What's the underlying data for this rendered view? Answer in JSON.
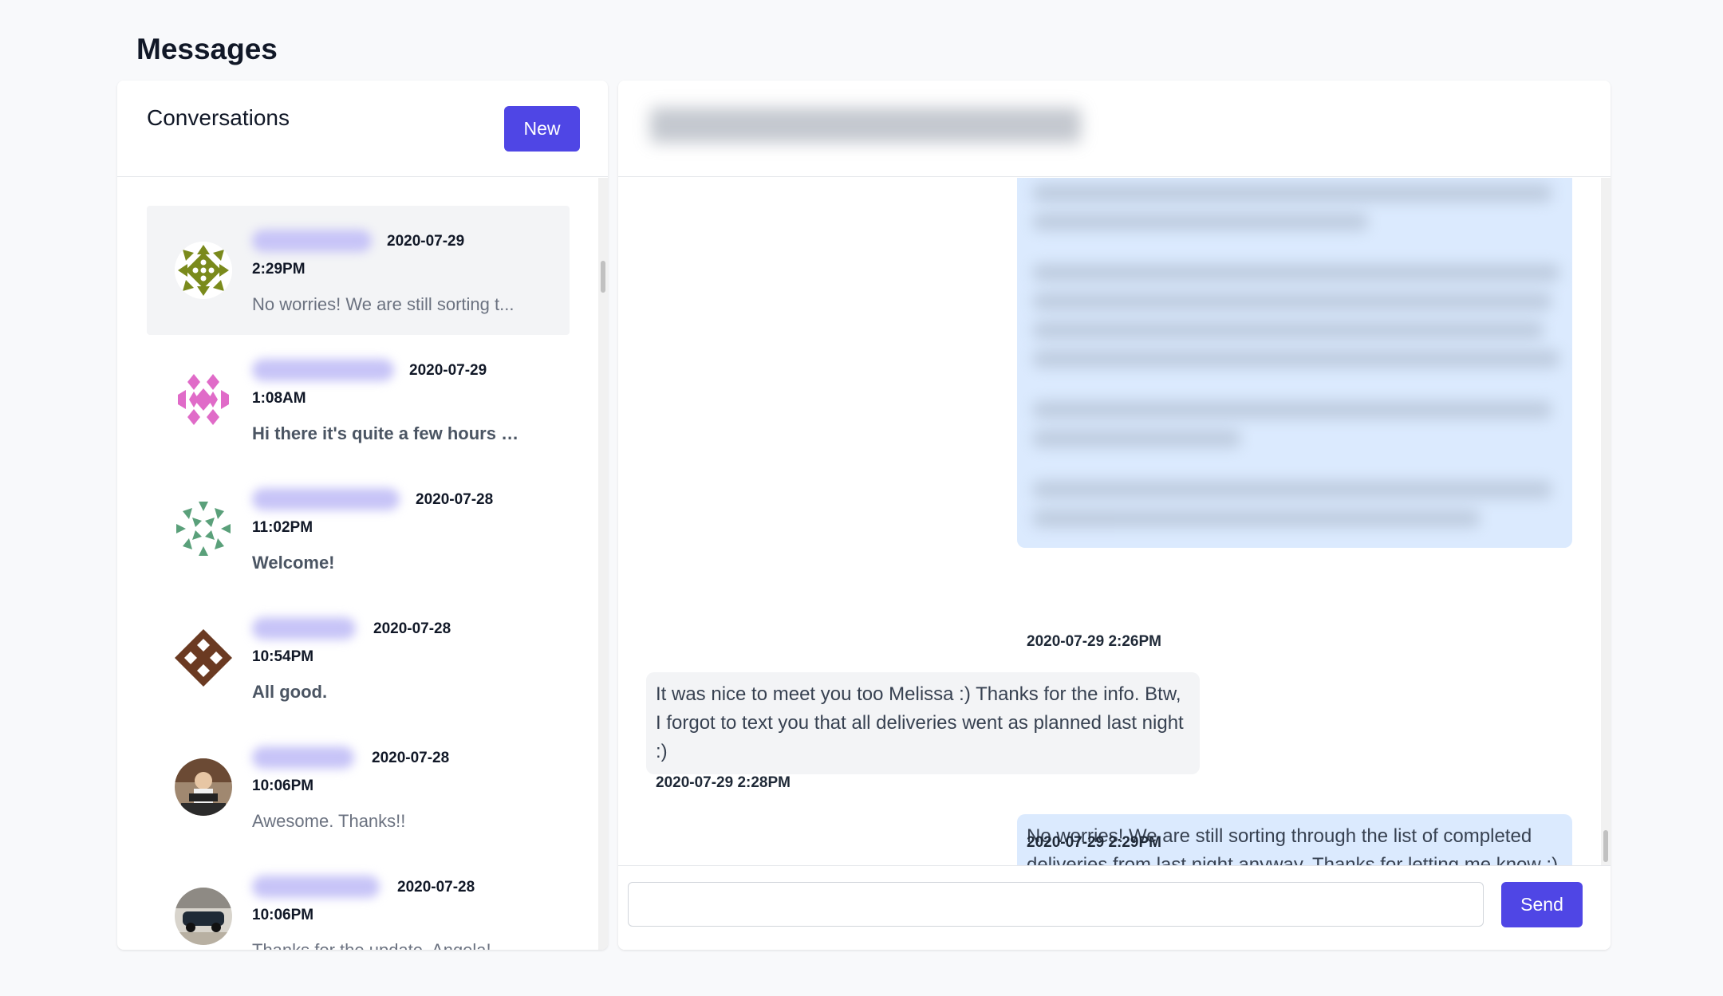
{
  "page": {
    "title": "Messages"
  },
  "conversations": {
    "heading": "Conversations",
    "new_label": "New",
    "items": [
      {
        "date": "2020-07-29",
        "time": "2:29PM",
        "preview": "No worries! We are still sorting t...",
        "unread": false,
        "active": true,
        "avatar": "identicon-olive",
        "color": "#7a8a1c"
      },
      {
        "date": "2020-07-29",
        "time": "1:08AM",
        "preview": "Hi there it's quite a few hours la...",
        "unread": true,
        "active": false,
        "avatar": "identicon-pink",
        "color": "#e06bc8"
      },
      {
        "date": "2020-07-28",
        "time": "11:02PM",
        "preview": "Welcome!",
        "unread": true,
        "active": false,
        "avatar": "identicon-green",
        "color": "#5aa07a"
      },
      {
        "date": "2020-07-28",
        "time": "10:54PM",
        "preview": "All good.",
        "unread": true,
        "active": false,
        "avatar": "identicon-brown",
        "color": "#6b3a22"
      },
      {
        "date": "2020-07-28",
        "time": "10:06PM",
        "preview": "Awesome. Thanks!!",
        "unread": false,
        "active": false,
        "avatar": "photo-avatar-person",
        "color": "#8a5a3c"
      },
      {
        "date": "2020-07-28",
        "time": "10:06PM",
        "preview": "Thanks for the update, Angela!",
        "unread": false,
        "active": false,
        "avatar": "photo-avatar-car",
        "color": "#5a6470"
      }
    ]
  },
  "chat": {
    "messages": [
      {
        "from": "me",
        "text": "",
        "blurred": true,
        "time": "2020-07-29 2:26PM"
      },
      {
        "from": "them",
        "text": "It was nice to meet you too Melissa :) Thanks for the info. Btw, I forgot to text you that all deliveries went as planned last night :)",
        "time": "2020-07-29 2:28PM"
      },
      {
        "from": "me",
        "text": "No worries! We are still sorting through the list of completed deliveries from last night anyway. Thanks for letting me know :)",
        "time": "2020-07-29 2:29PM"
      }
    ],
    "input_placeholder": "",
    "send_label": "Send"
  },
  "colors": {
    "accent": "#4f46e5",
    "my_bubble": "#dbeafe",
    "their_bubble": "#f3f4f6"
  }
}
